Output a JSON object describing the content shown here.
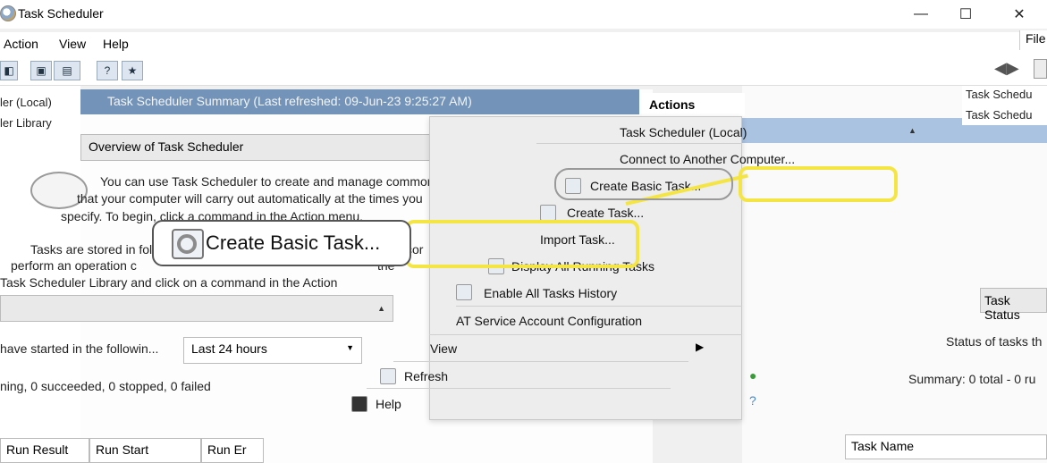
{
  "window": {
    "title": "Task Scheduler",
    "minimize": "—",
    "maximize": "☐",
    "close": "✕"
  },
  "menu": {
    "items": [
      "Action",
      "View",
      "Help"
    ],
    "right_file": "File"
  },
  "tree": {
    "root": "ler (Local)",
    "library": "ler Library",
    "right_root": "Task Schedu",
    "right_library": "Task Schedu"
  },
  "center": {
    "summary_title": "Task Scheduler Summary (Last refreshed: 09-Jun-23 9:25:27 AM)",
    "overview_heading": "Overview of Task Scheduler",
    "overview_text_1": "You can use Task Scheduler to create and manage common tasks",
    "overview_text_2": "that your computer will carry out automatically at the times you",
    "overview_text_3": "specify. To begin, click a command in the Action menu.",
    "tasks_text_1": "Tasks are stored in fol",
    "tasks_text_1b": "cor",
    "tasks_text_2": "perform an operation c",
    "tasks_text_2b": "the",
    "tasks_text_3": "Task Scheduler Library and click on a command in the Action",
    "status_text": "have started in the followin...",
    "period_value": "Last 24 hours",
    "summary_line": "ning, 0 succeeded, 0 stopped, 0 failed",
    "columns": [
      "Run Result",
      "Run Start",
      "Run Er"
    ]
  },
  "actions": {
    "header": "Actions",
    "task_status": "Task Status",
    "status_of_tasks": "Status of tasks th",
    "summary_right": "Summary: 0 total - 0 ru",
    "task_name": "Task Name"
  },
  "context_menu": {
    "items": [
      "Task Scheduler (Local)",
      "Connect to Another Computer...",
      "Create Basic Task...",
      "Create Task...",
      "Import Task...",
      "Display All Running Tasks",
      "Enable All Tasks History",
      "AT Service Account Configuration",
      "View",
      "Refresh",
      "Help"
    ],
    "view_arrow": "▶"
  },
  "callout": {
    "label": "Create Basic Task..."
  },
  "colors": {
    "highlight": "#f4e545",
    "summary_bar": "#7394b8",
    "actions_blue": "#aac3e0"
  }
}
